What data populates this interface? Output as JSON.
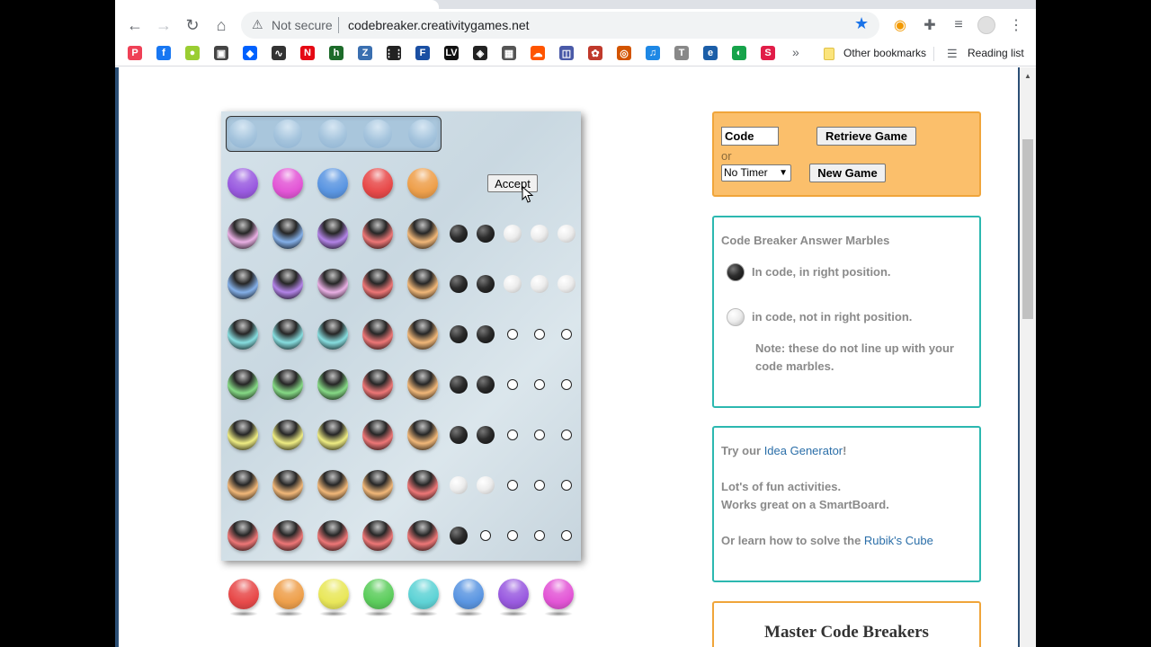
{
  "browser": {
    "security_label": "Not secure",
    "url": "codebreaker.creativitygames.net",
    "bookmarks_more": "»",
    "other_bookmarks": "Other bookmarks",
    "reading_list": "Reading list",
    "bookmark_icons": [
      {
        "name": "pocket",
        "glyph": "P",
        "color": "#ef4056"
      },
      {
        "name": "facebook",
        "glyph": "f",
        "color": "#1877f2"
      },
      {
        "name": "ext-lime",
        "glyph": "●",
        "color": "#9acd32"
      },
      {
        "name": "ext-box",
        "glyph": "▣",
        "color": "#444444"
      },
      {
        "name": "dropbox",
        "glyph": "◆",
        "color": "#0061fe"
      },
      {
        "name": "audio-wave",
        "glyph": "∿",
        "color": "#333333"
      },
      {
        "name": "netflix",
        "glyph": "N",
        "color": "#e50914"
      },
      {
        "name": "h-green",
        "glyph": "h",
        "color": "#1d6b2a"
      },
      {
        "name": "zotero",
        "glyph": "Z",
        "color": "#3a6fb0"
      },
      {
        "name": "grid-dots",
        "glyph": "⋮⋮",
        "color": "#222222"
      },
      {
        "name": "f-blue",
        "glyph": "F",
        "color": "#1a4fa3"
      },
      {
        "name": "lv",
        "glyph": "LV",
        "color": "#111111"
      },
      {
        "name": "unity",
        "glyph": "◈",
        "color": "#222222"
      },
      {
        "name": "table",
        "glyph": "▦",
        "color": "#555555"
      },
      {
        "name": "soundcloud",
        "glyph": "☁",
        "color": "#ff5500"
      },
      {
        "name": "cube",
        "glyph": "◫",
        "color": "#4a5aa8"
      },
      {
        "name": "gear-red",
        "glyph": "✿",
        "color": "#c0392b"
      },
      {
        "name": "ring",
        "glyph": "◎",
        "color": "#d35400"
      },
      {
        "name": "music",
        "glyph": "♫",
        "color": "#1e88e5"
      },
      {
        "name": "t-grey",
        "glyph": "T",
        "color": "#888888"
      },
      {
        "name": "e-blue",
        "glyph": "e",
        "color": "#1b5ea8"
      },
      {
        "name": "circle-green",
        "glyph": "◐",
        "color": "#16a34a"
      },
      {
        "name": "s-pink",
        "glyph": "S",
        "color": "#e11d48"
      }
    ]
  },
  "game": {
    "accept_label": "Accept",
    "secret_count": 5,
    "guesses": [
      {
        "marbles": [
          "purple",
          "magenta",
          "blue",
          "red",
          "orange"
        ],
        "pegs": [],
        "current": true
      },
      {
        "marbles": [
          "pink",
          "blue",
          "purple",
          "red",
          "orange"
        ],
        "pegs": [
          "black",
          "black",
          "white",
          "white",
          "white"
        ],
        "current": false
      },
      {
        "marbles": [
          "blue",
          "purple",
          "pink",
          "red",
          "orange"
        ],
        "pegs": [
          "black",
          "black",
          "white",
          "white",
          "white"
        ],
        "current": false
      },
      {
        "marbles": [
          "cyan",
          "cyan",
          "cyan",
          "red",
          "orange"
        ],
        "pegs": [
          "black",
          "black",
          "empty",
          "empty",
          "empty"
        ],
        "current": false
      },
      {
        "marbles": [
          "green",
          "green",
          "green",
          "red",
          "orange"
        ],
        "pegs": [
          "black",
          "black",
          "empty",
          "empty",
          "empty"
        ],
        "current": false
      },
      {
        "marbles": [
          "yellow",
          "yellow",
          "yellow",
          "red",
          "orange"
        ],
        "pegs": [
          "black",
          "black",
          "empty",
          "empty",
          "empty"
        ],
        "current": false
      },
      {
        "marbles": [
          "orange",
          "orange",
          "orange",
          "orange",
          "red"
        ],
        "pegs": [
          "white",
          "white",
          "empty",
          "empty",
          "empty"
        ],
        "current": false
      },
      {
        "marbles": [
          "red",
          "red",
          "red",
          "red",
          "red"
        ],
        "pegs": [
          "black",
          "empty",
          "empty",
          "empty",
          "empty"
        ],
        "current": false
      }
    ],
    "palette": [
      "red",
      "orange",
      "yellow",
      "green",
      "cyan",
      "blue",
      "purple",
      "magenta"
    ]
  },
  "colors": {
    "red": "#e84a4a",
    "orange": "#eea04c",
    "yellow": "#e9e75a",
    "green": "#5dcd5d",
    "cyan": "#5fd3d6",
    "blue": "#5b96e2",
    "purple": "#9a5be0",
    "magenta": "#e356d6",
    "pink": "#e395dc",
    "brand_orange": "#fbbf6b",
    "teal_border": "#2cb8b0"
  },
  "controls": {
    "code_value": "Code",
    "retrieve_label": "Retrieve Game",
    "or_label": "or",
    "timer_selected": "No Timer",
    "new_game_label": "New Game"
  },
  "legend": {
    "title": "Code Breaker Answer Marbles",
    "black_label": "In code, in right position.",
    "white_label": "in code, not in right position.",
    "note": "Note: these do not line up with your code marbles."
  },
  "promo": {
    "try_prefix": "Try our ",
    "idea_link": "Idea Generator",
    "try_suffix": "!",
    "fun_line": "Lot's of fun activities.",
    "smartboard_line": "Works great on a SmartBoard.",
    "rubik_prefix": "Or learn how to solve the ",
    "rubik_link": "Rubik's Cube"
  },
  "master": {
    "title": "Master Code Breakers"
  }
}
